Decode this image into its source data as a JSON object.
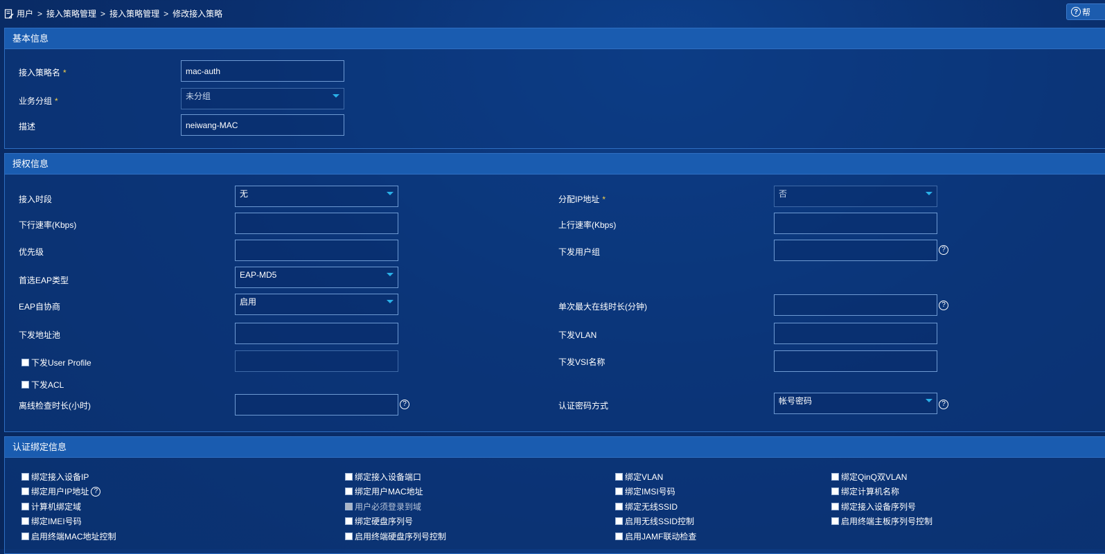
{
  "breadcrumb": {
    "items": [
      "用户",
      "接入策略管理",
      "接入策略管理",
      "修改接入策略"
    ],
    "separator": ">"
  },
  "help_button": {
    "label": "帮"
  },
  "basic": {
    "title": "基本信息",
    "policy_name_label": "接入策略名",
    "policy_name_value": "mac-auth",
    "group_label": "业务分组",
    "group_value": "未分组",
    "desc_label": "描述",
    "desc_value": "neiwang-MAC",
    "required_mark": "*"
  },
  "auth": {
    "title": "授权信息",
    "time_label": "接入时段",
    "time_value": "无",
    "assign_ip_label": "分配IP地址",
    "assign_ip_value": "否",
    "down_rate_label": "下行速率(Kbps)",
    "up_rate_label": "上行速率(Kbps)",
    "priority_label": "优先级",
    "user_group_label": "下发用户组",
    "eap_type_label": "首选EAP类型",
    "eap_type_value": "EAP-MD5",
    "eap_nego_label": "EAP自协商",
    "eap_nego_value": "启用",
    "max_online_label": "单次最大在线时长(分钟)",
    "addr_pool_label": "下发地址池",
    "vlan_label": "下发VLAN",
    "user_profile_label": "下发User Profile",
    "vsi_label": "下发VSI名称",
    "acl_label": "下发ACL",
    "offline_check_label": "离线检查时长(小时)",
    "auth_pwd_label": "认证密码方式",
    "auth_pwd_value": "帐号密码",
    "required_mark": "*"
  },
  "binding": {
    "title": "认证绑定信息",
    "items": [
      "绑定接入设备IP",
      "绑定接入设备端口",
      "绑定VLAN",
      "绑定QinQ双VLAN",
      "绑定用户IP地址",
      "绑定用户MAC地址",
      "绑定IMSI号码",
      "绑定计算机名称",
      "计算机绑定域",
      "用户必须登录到域",
      "绑定无线SSID",
      "绑定接入设备序列号",
      "绑定IMEI号码",
      "绑定硬盘序列号",
      "启用无线SSID控制",
      "启用终端主板序列号控制",
      "启用终端MAC地址控制",
      "启用终端硬盘序列号控制",
      "启用JAMF联动检查"
    ]
  },
  "colors": {
    "accent": "#2ab0e8",
    "panel_header": "#1a5cb0",
    "required": "#f7d34a"
  }
}
